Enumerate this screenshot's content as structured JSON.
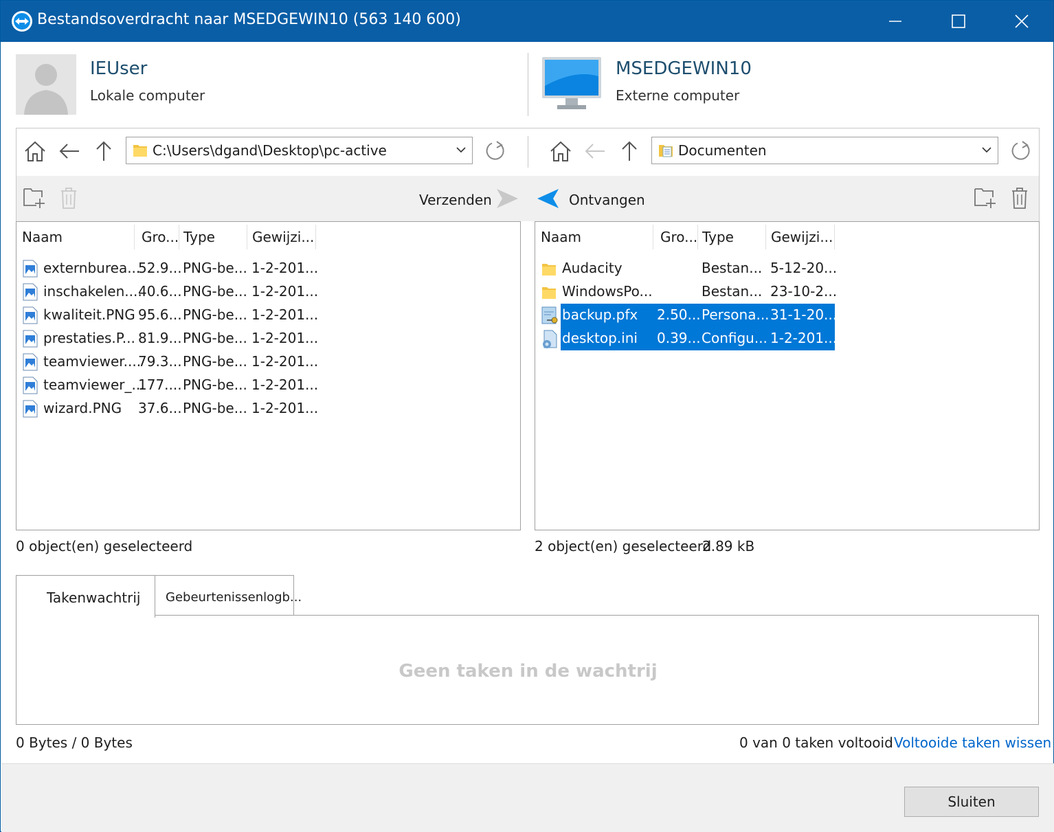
{
  "window": {
    "title": "Bestandsoverdracht naar MSEDGEWIN10 (563 140 600)"
  },
  "local": {
    "user_name": "IEUser",
    "user_sub": "Lokale computer",
    "path": "C:\\Users\\dgand\\Desktop\\pc-active",
    "send_label": "Verzenden",
    "columns": [
      "Naam",
      "Gro...",
      "Type",
      "Gewijzi..."
    ],
    "files": [
      {
        "name": "externburea...",
        "size": "52.9...",
        "type": "PNG-be...",
        "modified": "1-2-201..."
      },
      {
        "name": "inschakelen....",
        "size": "40.6...",
        "type": "PNG-be...",
        "modified": "1-2-201..."
      },
      {
        "name": "kwaliteit.PNG",
        "size": "95.6...",
        "type": "PNG-be...",
        "modified": "1-2-201..."
      },
      {
        "name": "prestaties.P...",
        "size": "81.9...",
        "type": "PNG-be...",
        "modified": "1-2-201..."
      },
      {
        "name": "teamviewer....",
        "size": "79.3...",
        "type": "PNG-be...",
        "modified": "1-2-201..."
      },
      {
        "name": "teamviewer_...",
        "size": "177....",
        "type": "PNG-be...",
        "modified": "1-2-201..."
      },
      {
        "name": "wizard.PNG",
        "size": "37.6...",
        "type": "PNG-be...",
        "modified": "1-2-201..."
      }
    ],
    "status": "0 object(en) geselecteerd"
  },
  "remote": {
    "computer_name": "MSEDGEWIN10",
    "computer_sub": "Externe computer",
    "path": "Documenten",
    "receive_label": "Ontvangen",
    "columns": [
      "Naam",
      "Gro...",
      "Type",
      "Gewijzi..."
    ],
    "files": [
      {
        "name": "Audacity",
        "size": "",
        "type": "Bestan...",
        "modified": "5-12-20...",
        "kind": "folder",
        "selected": false
      },
      {
        "name": "WindowsPo...",
        "size": "",
        "type": "Bestan...",
        "modified": "23-10-2...",
        "kind": "folder",
        "selected": false
      },
      {
        "name": "backup.pfx",
        "size": "2.50...",
        "type": "Persona...",
        "modified": "31-1-20...",
        "kind": "cert",
        "selected": true
      },
      {
        "name": "desktop.ini",
        "size": "0.39...",
        "type": "Configu...",
        "modified": "1-2-201...",
        "kind": "config",
        "selected": true
      }
    ],
    "status": "2 object(en) geselecteerd",
    "status_size": "2.89 kB"
  },
  "queue": {
    "tabs": [
      "Takenwachtrij",
      "Gebeurtenissenlogb..."
    ],
    "empty_message": "Geen taken in de wachtrij",
    "bytes": "0 Bytes / 0 Bytes",
    "completed": "0 van 0 taken voltooid",
    "clear_link": "Voltooide taken wissen"
  },
  "footer": {
    "close_label": "Sluiten"
  },
  "colors": {
    "titlebar": "#0a5ea6",
    "selection": "#0078d7",
    "link": "#0066cc"
  }
}
